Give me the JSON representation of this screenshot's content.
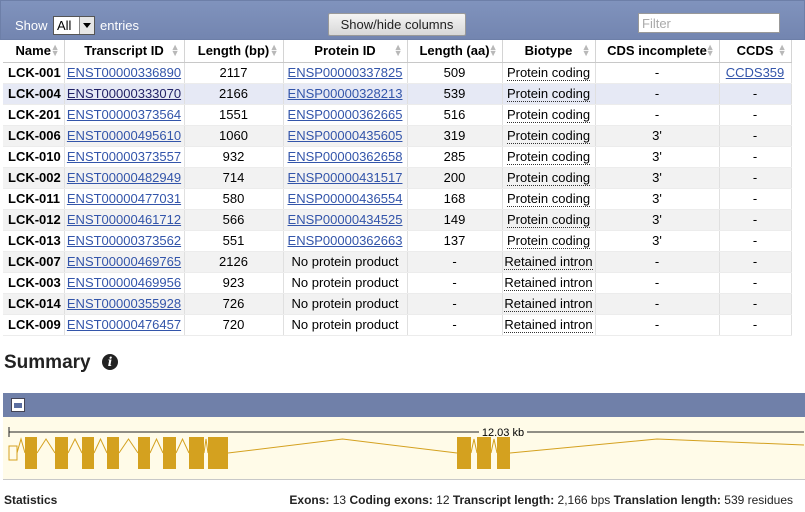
{
  "controls": {
    "show_label": "Show",
    "entries_value": "All",
    "entries_label": "entries",
    "showhide_label": "Show/hide columns",
    "filter_placeholder": "Filter"
  },
  "table": {
    "columns": [
      "Name",
      "Transcript ID",
      "Length (bp)",
      "Protein ID",
      "Length (aa)",
      "Biotype",
      "CDS incomplete",
      "CCDS"
    ],
    "rows": [
      {
        "name": "LCK-001",
        "transcript": "ENST00000336890",
        "length_bp": "2117",
        "protein": "ENSP00000337825",
        "length_aa": "509",
        "biotype": "Protein coding",
        "cds_incomplete": "-",
        "ccds": "CCDS359"
      },
      {
        "name": "LCK-004",
        "transcript": "ENST00000333070",
        "length_bp": "2166",
        "protein": "ENSP00000328213",
        "length_aa": "539",
        "biotype": "Protein coding",
        "cds_incomplete": "-",
        "ccds": "-"
      },
      {
        "name": "LCK-201",
        "transcript": "ENST00000373564",
        "length_bp": "1551",
        "protein": "ENSP00000362665",
        "length_aa": "516",
        "biotype": "Protein coding",
        "cds_incomplete": "-",
        "ccds": "-"
      },
      {
        "name": "LCK-006",
        "transcript": "ENST00000495610",
        "length_bp": "1060",
        "protein": "ENSP00000435605",
        "length_aa": "319",
        "biotype": "Protein coding",
        "cds_incomplete": "3'",
        "ccds": "-"
      },
      {
        "name": "LCK-010",
        "transcript": "ENST00000373557",
        "length_bp": "932",
        "protein": "ENSP00000362658",
        "length_aa": "285",
        "biotype": "Protein coding",
        "cds_incomplete": "3'",
        "ccds": "-"
      },
      {
        "name": "LCK-002",
        "transcript": "ENST00000482949",
        "length_bp": "714",
        "protein": "ENSP00000431517",
        "length_aa": "200",
        "biotype": "Protein coding",
        "cds_incomplete": "3'",
        "ccds": "-"
      },
      {
        "name": "LCK-011",
        "transcript": "ENST00000477031",
        "length_bp": "580",
        "protein": "ENSP00000436554",
        "length_aa": "168",
        "biotype": "Protein coding",
        "cds_incomplete": "3'",
        "ccds": "-"
      },
      {
        "name": "LCK-012",
        "transcript": "ENST00000461712",
        "length_bp": "566",
        "protein": "ENSP00000434525",
        "length_aa": "149",
        "biotype": "Protein coding",
        "cds_incomplete": "3'",
        "ccds": "-"
      },
      {
        "name": "LCK-013",
        "transcript": "ENST00000373562",
        "length_bp": "551",
        "protein": "ENSP00000362663",
        "length_aa": "137",
        "biotype": "Protein coding",
        "cds_incomplete": "3'",
        "ccds": "-"
      },
      {
        "name": "LCK-007",
        "transcript": "ENST00000469765",
        "length_bp": "2126",
        "protein": "No protein product",
        "length_aa": "-",
        "biotype": "Retained intron",
        "cds_incomplete": "-",
        "ccds": "-"
      },
      {
        "name": "LCK-003",
        "transcript": "ENST00000469956",
        "length_bp": "923",
        "protein": "No protein product",
        "length_aa": "-",
        "biotype": "Retained intron",
        "cds_incomplete": "-",
        "ccds": "-"
      },
      {
        "name": "LCK-014",
        "transcript": "ENST00000355928",
        "length_bp": "726",
        "protein": "No protein product",
        "length_aa": "-",
        "biotype": "Retained intron",
        "cds_incomplete": "-",
        "ccds": "-"
      },
      {
        "name": "LCK-009",
        "transcript": "ENST00000476457",
        "length_bp": "720",
        "protein": "No protein product",
        "length_aa": "-",
        "biotype": "Retained intron",
        "cds_incomplete": "-",
        "ccds": "-"
      }
    ]
  },
  "summary": {
    "title": "Summary",
    "scale_label": "12.03 kb"
  },
  "stats": {
    "label": "Statistics",
    "exons_label": "Exons:",
    "exons_value": "13",
    "coding_exons_label": "Coding exons:",
    "coding_exons_value": "12",
    "transcript_length_label": "Transcript length:",
    "transcript_length_value": "2,166 bps",
    "translation_length_label": "Translation length:",
    "translation_length_value": "539 residues"
  },
  "colors": {
    "header_bar": "#7b8cb6",
    "link": "#3355aa",
    "exon": "#d4a11f",
    "panel_bg": "#fffbe8"
  }
}
